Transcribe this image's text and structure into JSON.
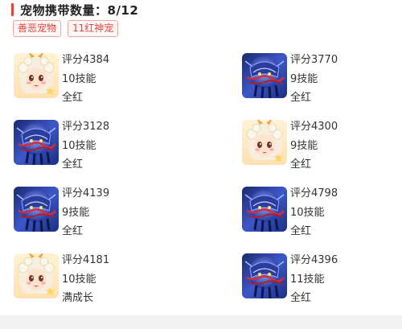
{
  "header": {
    "title": "宠物携带数量：8/12"
  },
  "tags": [
    "善恶宠物",
    "11红神宠"
  ],
  "pets": [
    {
      "avatar": "goat-girl",
      "score": "评分4384",
      "skills": "10技能",
      "status": "全红"
    },
    {
      "avatar": "armored-beast",
      "score": "评分3770",
      "skills": "9技能",
      "status": "全红"
    },
    {
      "avatar": "armored-beast",
      "score": "评分3128",
      "skills": "10技能",
      "status": "全红"
    },
    {
      "avatar": "goat-girl",
      "score": "评分4300",
      "skills": "9技能",
      "status": "全红"
    },
    {
      "avatar": "armored-beast",
      "score": "评分4139",
      "skills": "9技能",
      "status": "全红"
    },
    {
      "avatar": "armored-beast",
      "score": "评分4798",
      "skills": "10技能",
      "status": "全红"
    },
    {
      "avatar": "goat-girl",
      "score": "评分4181",
      "skills": "10技能",
      "status": "满成长"
    },
    {
      "avatar": "armored-beast",
      "score": "评分4396",
      "skills": "11技能",
      "status": "全红"
    }
  ],
  "colors": {
    "accent": "#e0463f",
    "tag_border": "#f0a7a4"
  }
}
